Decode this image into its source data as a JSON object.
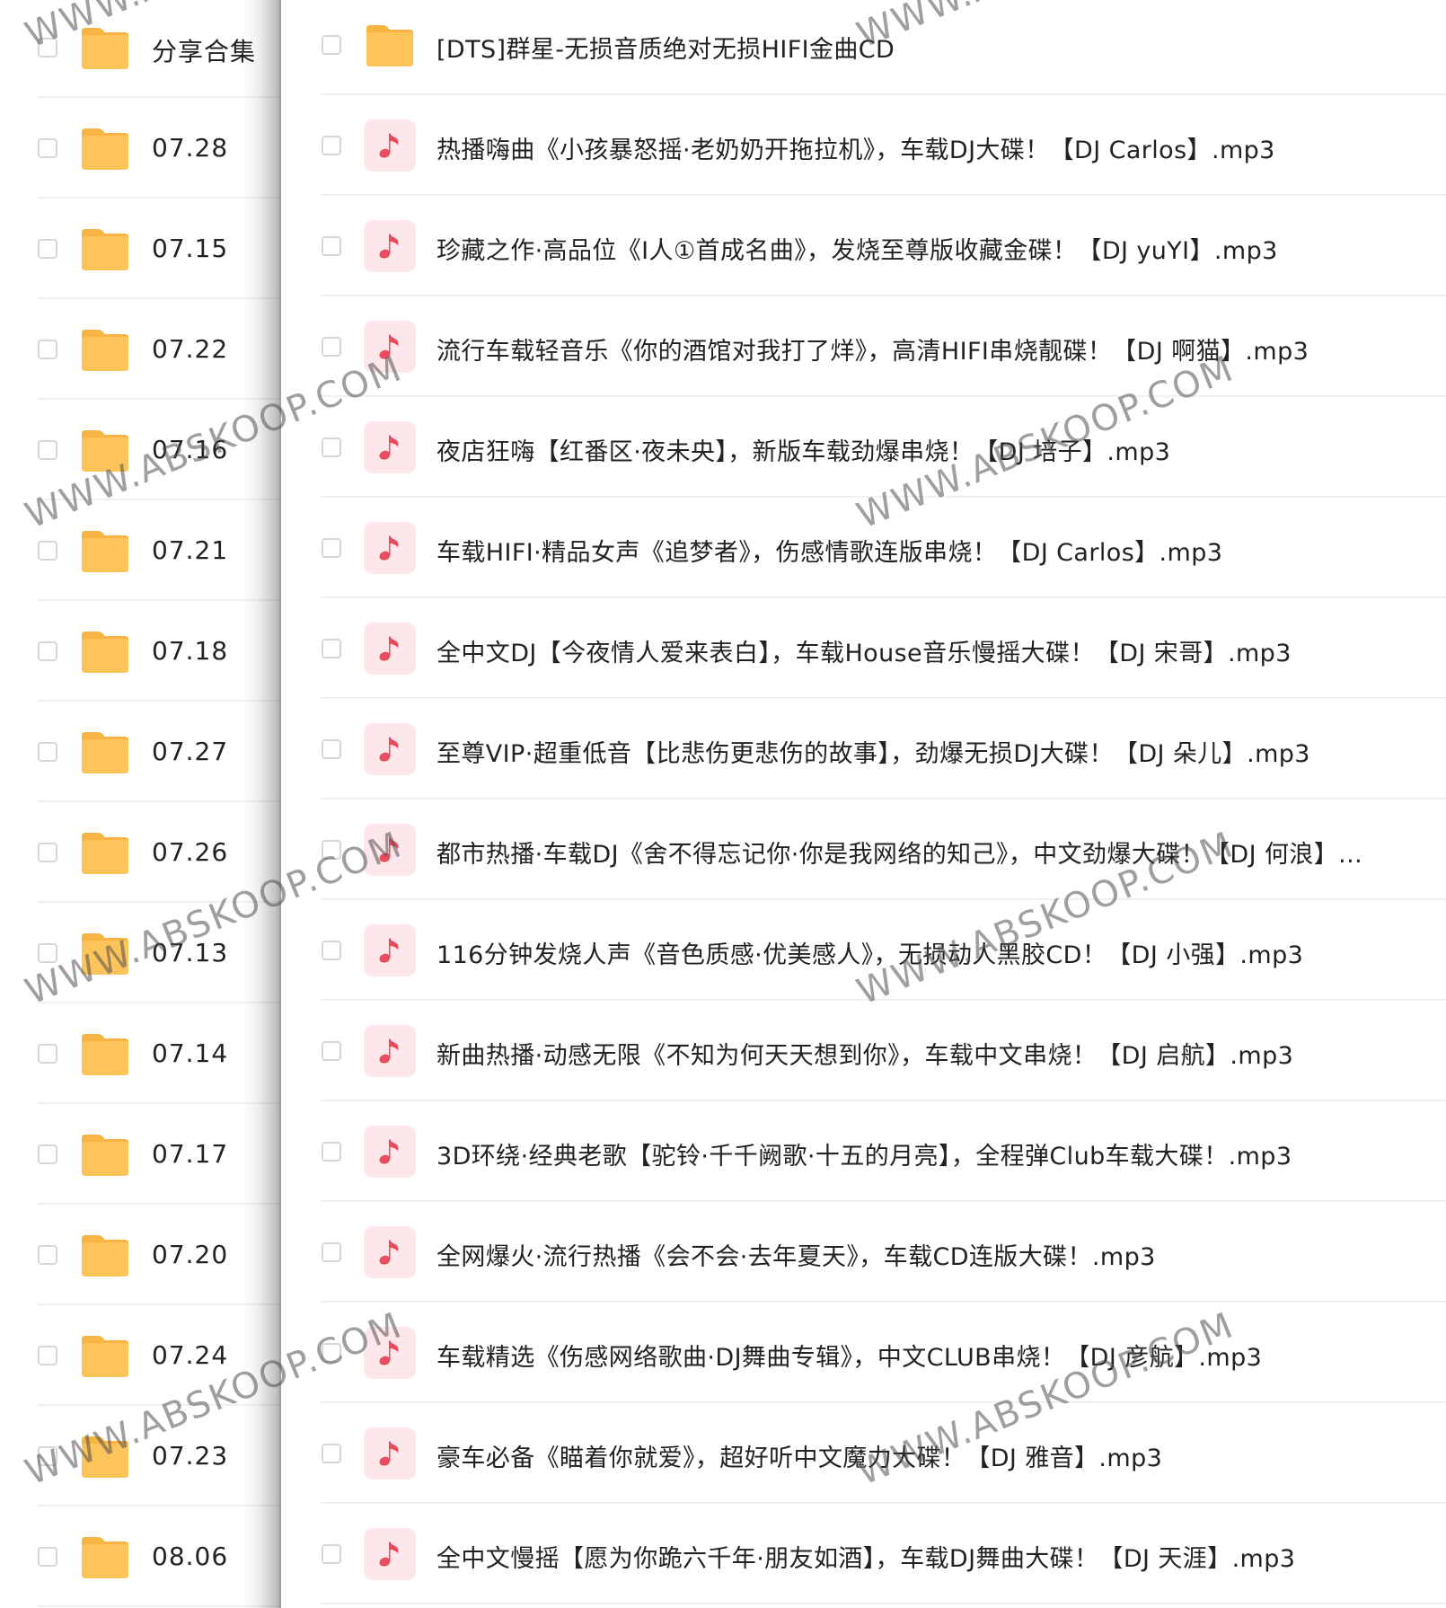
{
  "left_items": [
    {
      "label": "分享合集"
    },
    {
      "label": "07.28"
    },
    {
      "label": "07.15"
    },
    {
      "label": "07.22"
    },
    {
      "label": "07.16"
    },
    {
      "label": "07.21"
    },
    {
      "label": "07.18"
    },
    {
      "label": "07.27"
    },
    {
      "label": "07.26"
    },
    {
      "label": "07.13"
    },
    {
      "label": "07.14"
    },
    {
      "label": "07.17"
    },
    {
      "label": "07.20"
    },
    {
      "label": "07.24"
    },
    {
      "label": "07.23"
    },
    {
      "label": "08.06"
    }
  ],
  "right_items": [
    {
      "type": "folder",
      "label": "[DTS]群星-无损音质绝对无损HIFI金曲CD"
    },
    {
      "type": "music",
      "label": "热播嗨曲《小孩暴怒摇·老奶奶开拖拉机》，车载DJ大碟！【DJ Carlos】.mp3"
    },
    {
      "type": "music",
      "label": "珍藏之作·高品位《I人①首成名曲》，发烧至尊版收藏金碟！【DJ yuYI】.mp3"
    },
    {
      "type": "music",
      "label": "流行车载轻音乐《你的酒馆对我打了烊》，高清HIFI串烧靓碟！【DJ 啊猫】.mp3"
    },
    {
      "type": "music",
      "label": "夜店狂嗨【红番区·夜未央】，新版车载劲爆串烧！【DJ 培子】.mp3"
    },
    {
      "type": "music",
      "label": "车载HIFI·精品女声《追梦者》，伤感情歌连版串烧！【DJ Carlos】.mp3"
    },
    {
      "type": "music",
      "label": "全中文DJ【今夜情人爱来表白】，车载House音乐慢摇大碟！【DJ 宋哥】.mp3"
    },
    {
      "type": "music",
      "label": "至尊VIP·超重低音【比悲伤更悲伤的故事】，劲爆无损DJ大碟！【DJ 朵儿】.mp3"
    },
    {
      "type": "music",
      "label": "都市热播·车载DJ《舍不得忘记你·你是我网络的知己》，中文劲爆大碟！【DJ 何浪】..."
    },
    {
      "type": "music",
      "label": "116分钟发烧人声《音色质感·优美感人》，无损动人黑胶CD！【DJ 小强】.mp3"
    },
    {
      "type": "music",
      "label": "新曲热播·动感无限《不知为何天天想到你》，车载中文串烧！【DJ 启航】.mp3"
    },
    {
      "type": "music",
      "label": "3D环绕·经典老歌【驼铃·千千阙歌·十五的月亮】，全程弹Club车载大碟！.mp3"
    },
    {
      "type": "music",
      "label": "全网爆火·流行热播《会不会·去年夏天》，车载CD连版大碟！.mp3"
    },
    {
      "type": "music",
      "label": "车载精选《伤感网络歌曲·DJ舞曲专辑》，中文CLUB串烧！【DJ 彦航】.mp3"
    },
    {
      "type": "music",
      "label": "豪车必备《瞄着你就爱》，超好听中文魔力大碟！【DJ 雅音】.mp3"
    },
    {
      "type": "music",
      "label": "全中文慢摇【愿为你跪六千年·朋友如酒】，车载DJ舞曲大碟！【DJ 天涯】.mp3"
    }
  ],
  "watermark": "WWW.ABSKOOP.COM",
  "colors": {
    "folder": "#fcc45a",
    "folder_tab": "#f7b440",
    "music_bg": "#fde7ea",
    "music_note": "#ec4a5d"
  },
  "icons": {
    "folder": "folder-icon",
    "music": "music-note-icon"
  }
}
